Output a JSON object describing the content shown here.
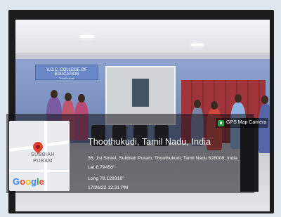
{
  "scene": {
    "banner_text": "V.O.C. COLLEGE OF EDUCATION",
    "banner_subtext": "Thoothukudi"
  },
  "gps_badge": {
    "icon": "gps-map-camera-icon",
    "label": "GPS Map Camera"
  },
  "map": {
    "place_label_line1": "SUBBIAH",
    "place_label_line2": "PURAM",
    "logo_text": "Google",
    "pin_icon": "map-pin-icon"
  },
  "location": {
    "title": "Thoothukudi, Tamil Nadu, India",
    "address": "36, 1st Street, Subbiah Puram, Thoothukudi, Tamil Nadu 628008, India",
    "latitude": "Lat 8.79458°",
    "longitude": "Long 78.129318°",
    "datetime": "17/06/22 12:31 PM"
  },
  "colors": {
    "pin": "#e34133",
    "google_blue": "#4285f4",
    "google_red": "#ea4335",
    "google_yellow": "#fbbc05",
    "google_green": "#34a853"
  }
}
